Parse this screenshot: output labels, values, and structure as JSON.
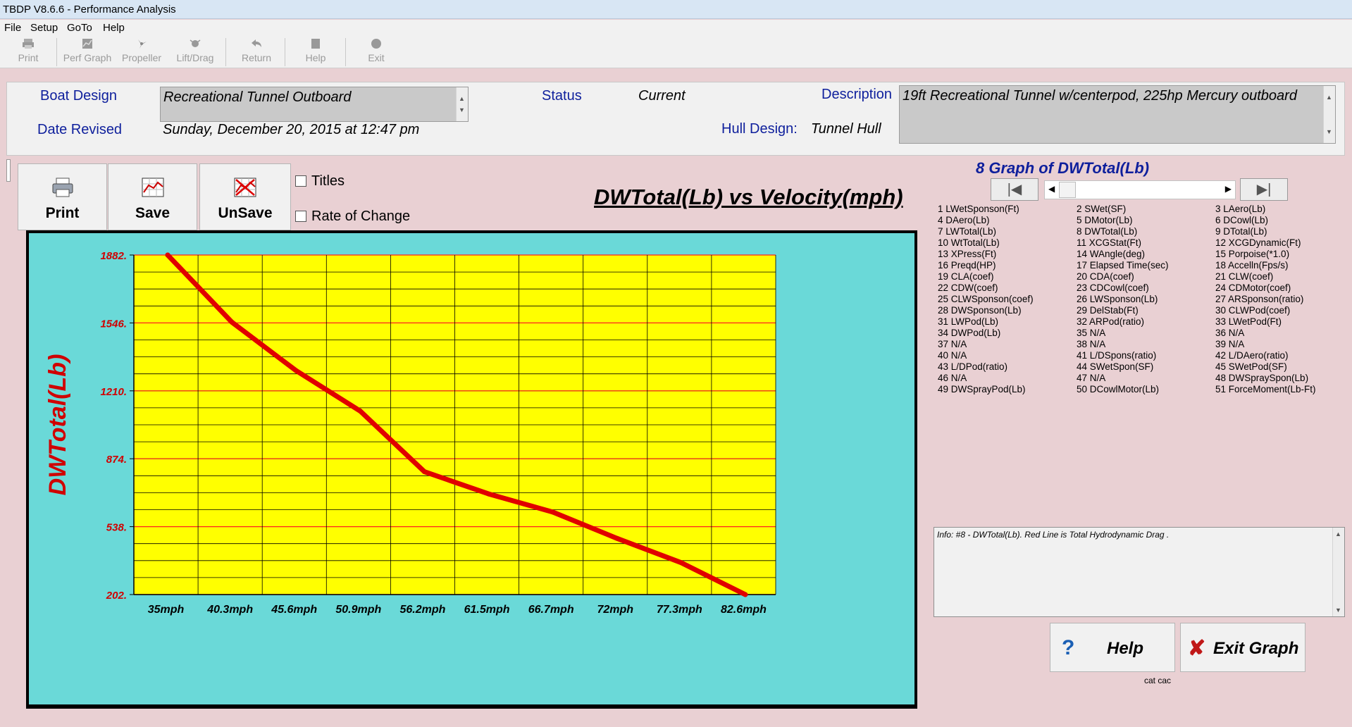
{
  "window": {
    "title": "TBDP V8.6.6 - Performance Analysis"
  },
  "menu": [
    "File",
    "Setup",
    "GoTo",
    "Help"
  ],
  "toolbar": {
    "print": "Print",
    "perf_graph": "Perf Graph",
    "propeller": "Propeller",
    "lift_drag": "Lift/Drag",
    "return": "Return",
    "help": "Help",
    "exit": "Exit"
  },
  "header": {
    "boat_design_label": "Boat Design",
    "boat_design_value": "Recreational Tunnel Outboard",
    "date_revised_label": "Date Revised",
    "date_revised_value": "Sunday, December 20, 2015 at 12:47 pm",
    "status_label": "Status",
    "status_value": "Current",
    "hull_design_label": "Hull Design:",
    "hull_design_value": "Tunnel Hull",
    "description_label": "Description",
    "description_value": "19ft Recreational Tunnel w/centerpod, 225hp Mercury outboard"
  },
  "graph_buttons": {
    "print": "Print",
    "save": "Save",
    "unsave": "UnSave"
  },
  "options": {
    "titles": "Titles",
    "rate_of_change": "Rate of Change"
  },
  "graph_title": "DWTotal(Lb) vs Velocity(mph)",
  "colors": {
    "plot_bg": "#ffff00",
    "frame_bg": "#6ad9d8",
    "line": "#e00000",
    "label": "#d00000",
    "accent_blue": "#0e1f9c"
  },
  "chart_data": {
    "type": "line",
    "title": "DWTotal(Lb) vs Velocity(mph)",
    "xlabel": "",
    "ylabel": "DWTotal(Lb)",
    "categories": [
      "35mph",
      "40.3mph",
      "45.6mph",
      "50.9mph",
      "56.2mph",
      "61.5mph",
      "66.7mph",
      "72mph",
      "77.3mph",
      "82.6mph"
    ],
    "y_ticks": [
      "1882.",
      "1546.",
      "1210.",
      "874.",
      "538.",
      "202."
    ],
    "ylim": [
      202,
      1882
    ],
    "grid": true,
    "series": [
      {
        "x": [
          35,
          40.3,
          45.6,
          50.9,
          56.2,
          61.5,
          66.7,
          72,
          77.3,
          82.6
        ],
        "values": [
          1882,
          1550,
          1310,
          1110,
          810,
          700,
          610,
          480,
          360,
          202
        ]
      }
    ]
  },
  "right_panel": {
    "title": "8 Graph of DWTotal(Lb)",
    "variables": [
      [
        "1 LWetSponson(Ft)",
        "4 DAero(Lb)",
        "7 LWTotal(Lb)",
        "10 WtTotal(Lb)",
        "13 XPress(Ft)",
        "16 Preqd(HP)",
        "19 CLA(coef)",
        "22 CDW(coef)",
        "25 CLWSponson(coef)",
        "28 DWSponson(Lb)",
        "31 LWPod(Lb)",
        "34 DWPod(Lb)",
        "37 N/A",
        "40 N/A",
        "43 L/DPod(ratio)",
        "46 N/A",
        "49 DWSprayPod(Lb)"
      ],
      [
        "2 SWet(SF)",
        "5 DMotor(Lb)",
        "8 DWTotal(Lb)",
        "11 XCGStat(Ft)",
        "14 WAngle(deg)",
        "17 Elapsed Time(sec)",
        "20 CDA(coef)",
        "23 CDCowl(coef)",
        "26 LWSponson(Lb)",
        "29 DelStab(Ft)",
        "32 ARPod(ratio)",
        "35 N/A",
        "38 N/A",
        "41 L/DSpons(ratio)",
        "44 SWetSpon(SF)",
        "47 N/A",
        "50 DCowlMotor(Lb)"
      ],
      [
        "3 LAero(Lb)",
        "6 DCowl(Lb)",
        "9 DTotal(Lb)",
        "12 XCGDynamic(Ft)",
        "15 Porpoise(*1.0)",
        "18 Accelln(Fps/s)",
        "21 CLW(coef)",
        "24 CDMotor(coef)",
        "27 ARSponson(ratio)",
        "30 CLWPod(coef)",
        "33 LWetPod(Ft)",
        "36 N/A",
        "39 N/A",
        "42 L/DAero(ratio)",
        "45 SWetPod(SF)",
        "48 DWSpraySpon(Lb)",
        "51 ForceMoment(Lb-Ft)"
      ]
    ],
    "info": "Info: #8 - DWTotal(Lb). Red Line is Total Hydrodynamic Drag  .",
    "help_button": "Help",
    "exit_button": "Exit Graph",
    "footer": "cat cac"
  }
}
